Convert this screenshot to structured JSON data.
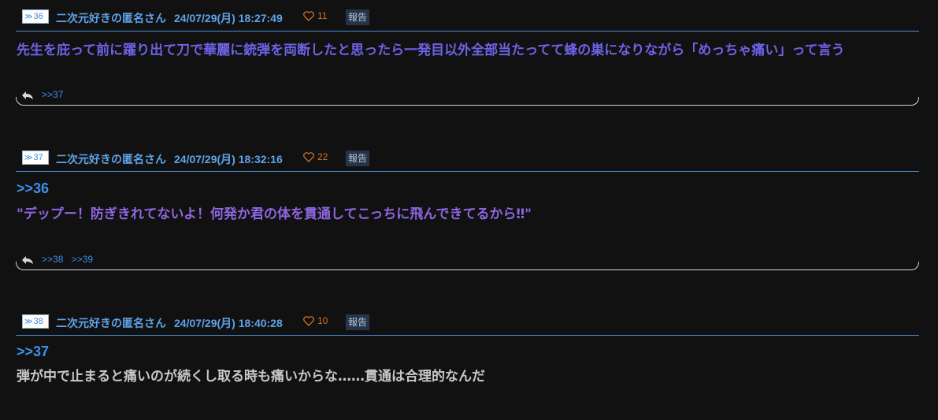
{
  "posts": [
    {
      "number": "36",
      "author": "二次元好きの匿名さん",
      "timestamp": "24/07/29(月) 18:27:49",
      "likes": "11",
      "report_label": "報告",
      "anchor": "",
      "text": "先生を庇って前に躍り出て刀で華麗に銃弾を両断したと思ったら一発目以外全部当たってて蜂の巣になりながら「めっちゃ痛い」って言う",
      "text_color": "#6e62e6",
      "replies": [
        ">>37"
      ]
    },
    {
      "number": "37",
      "author": "二次元好きの匿名さん",
      "timestamp": "24/07/29(月) 18:32:16",
      "likes": "22",
      "report_label": "報告",
      "anchor": ">>36",
      "text": "\"デップー！防ぎきれてないよ！何発か君の体を貫通してこっちに飛んできてるから‼\"",
      "text_color": "#8f66e0",
      "replies": [
        ">>38",
        ">>39"
      ]
    },
    {
      "number": "38",
      "author": "二次元好きの匿名さん",
      "timestamp": "24/07/29(月) 18:40:28",
      "likes": "10",
      "report_label": "報告",
      "anchor": ">>37",
      "text": "弾が中で止まると痛いのが続くし取る時も痛いからな……貫通は合理的なんだ",
      "text_color": "#c8c8c8",
      "replies": []
    }
  ],
  "icons": {
    "number_marker": "double-chevron-icon",
    "like": "heart-icon",
    "reply": "reply-arrow-icon"
  },
  "colors": {
    "background": "#111112",
    "accent": "#4a8fd1",
    "likes": "#d0742a"
  }
}
